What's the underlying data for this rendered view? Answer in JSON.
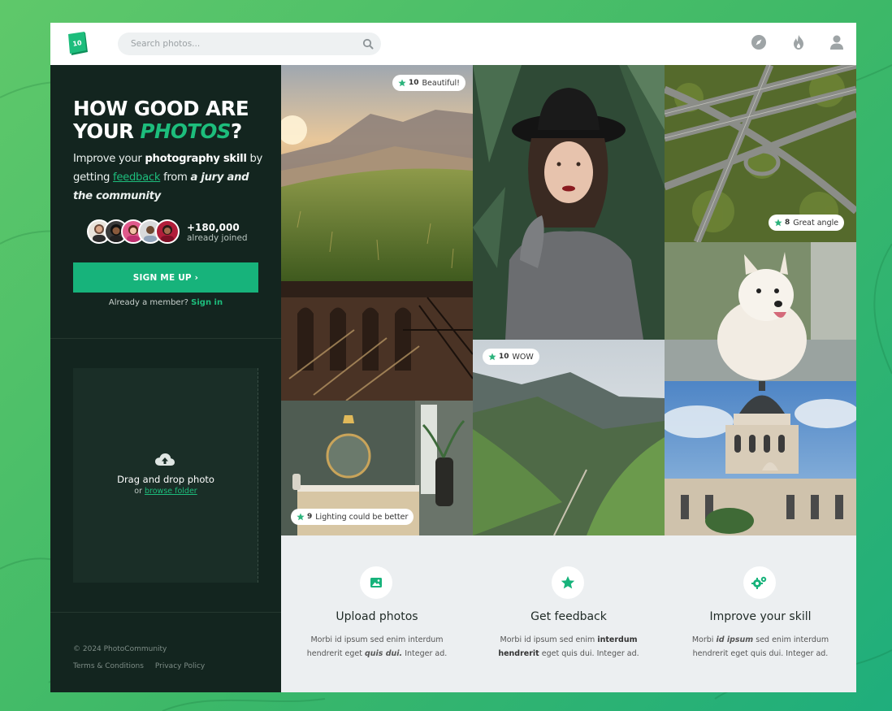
{
  "search": {
    "placeholder": "Search photos..."
  },
  "logo": {
    "text": "10"
  },
  "hero": {
    "title_line1": "HOW GOOD ARE",
    "title_line2_prefix": "YOUR ",
    "title_accent": "PHOTOS",
    "title_suffix": "?",
    "sub_1": "Improve your ",
    "sub_bold": "photography skill",
    "sub_2": " by getting ",
    "sub_link": "feedback",
    "sub_3": " from ",
    "sub_italic": "a jury and the community"
  },
  "community": {
    "count": "+180,000",
    "label": "already joined"
  },
  "signup": {
    "label": "SIGN ME UP ›",
    "member_text": "Already a member? ",
    "signin": "Sign in"
  },
  "dropzone": {
    "title": "Drag and drop photo",
    "or": "or ",
    "browse": "browse folder"
  },
  "footer": {
    "copyright": "© 2024 PhotoCommunity",
    "terms": "Terms & Conditions",
    "privacy": "Privacy Policy"
  },
  "gallery": {
    "badges": [
      {
        "score": "10",
        "text": "Beautiful!"
      },
      {
        "score": "8",
        "text": "Great angle"
      },
      {
        "score": "10",
        "text": "WOW"
      },
      {
        "score": "9",
        "text": "Lighting could be better"
      }
    ]
  },
  "features": [
    {
      "title": "Upload photos",
      "desc_1": "Morbi id ipsum sed enim interdum hendrerit eget ",
      "desc_em": "quis dui.",
      "desc_2": " Integer ad."
    },
    {
      "title": "Get feedback",
      "desc_1": "Morbi id ipsum sed enim ",
      "desc_em": "interdum hendrerit",
      "desc_2": " eget quis dui. Integer ad."
    },
    {
      "title": "Improve your skill",
      "desc_1": "Morbi ",
      "desc_em": "id ipsum",
      "desc_2": " sed enim interdum hendrerit eget quis dui. Integer ad."
    }
  ],
  "colors": {
    "accent": "#17b37b",
    "panel": "#13251f",
    "features_bg": "#eceff1"
  }
}
